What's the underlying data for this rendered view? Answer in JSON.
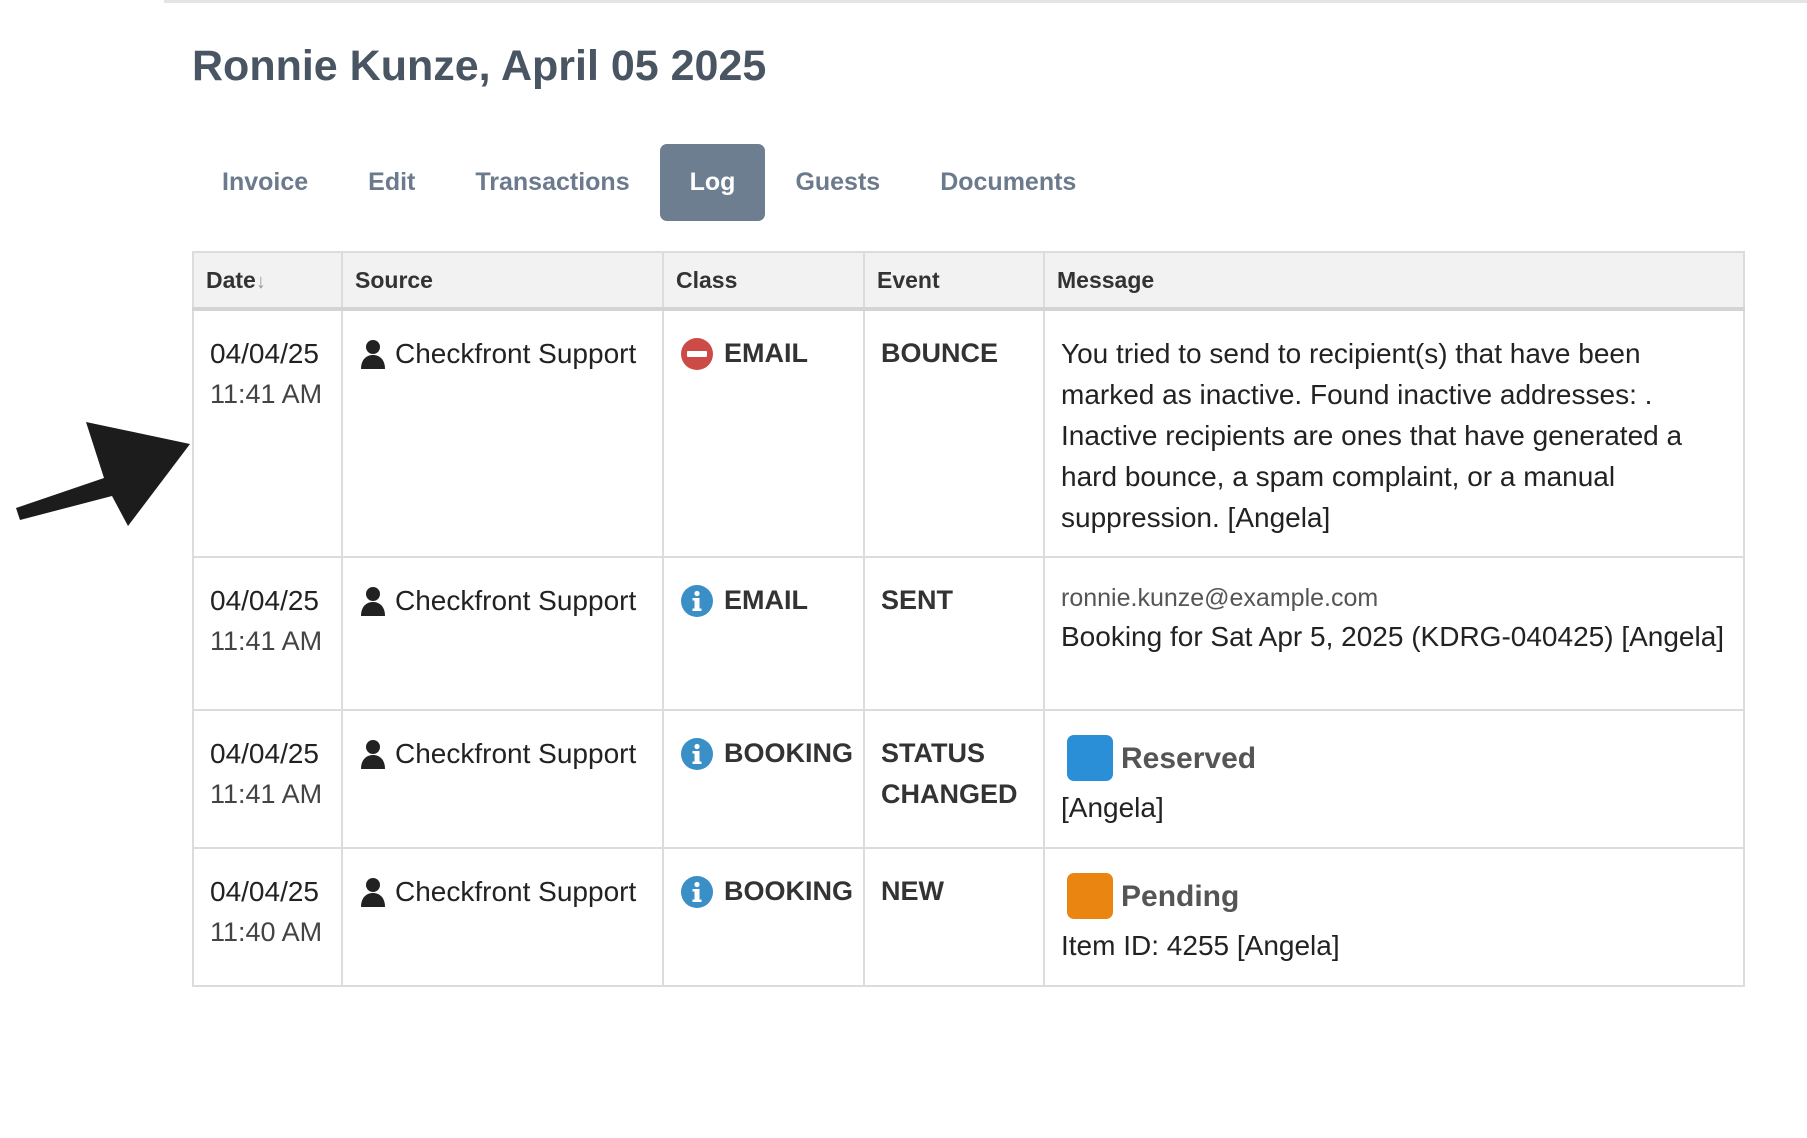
{
  "page": {
    "title": "Ronnie Kunze, April 05 2025"
  },
  "tabs": [
    {
      "label": "Invoice",
      "active": false
    },
    {
      "label": "Edit",
      "active": false
    },
    {
      "label": "Transactions",
      "active": false
    },
    {
      "label": "Log",
      "active": true
    },
    {
      "label": "Guests",
      "active": false
    },
    {
      "label": "Documents",
      "active": false
    }
  ],
  "table": {
    "columns": {
      "date": "Date",
      "date_sort_icon": "↓",
      "source": "Source",
      "class": "Class",
      "event": "Event",
      "message": "Message"
    },
    "rows": [
      {
        "date": "04/04/25",
        "time": "11:41 AM",
        "source": "Checkfront Support",
        "class_icon": "no-entry-icon",
        "class": "EMAIL",
        "event": "BOUNCE",
        "message": "You tried to send to recipient(s) that have been marked as inactive. Found inactive addresses: . Inactive recipients are ones that have generated a hard bounce, a spam complaint, or a manual suppression. [Angela]"
      },
      {
        "date": "04/04/25",
        "time": "11:41 AM",
        "source": "Checkfront Support",
        "class_icon": "info-icon",
        "class": "EMAIL",
        "event": "SENT",
        "message_email": "ronnie.kunze@example.com",
        "message": "Booking for Sat Apr 5, 2025 (KDRG-040425) [Angela]"
      },
      {
        "date": "04/04/25",
        "time": "11:41 AM",
        "source": "Checkfront Support",
        "class_icon": "info-icon",
        "class": "BOOKING",
        "event": "STATUS CHANGED",
        "badge_label": "Reserved",
        "badge_color": "#2a8fd6",
        "message": "[Angela]"
      },
      {
        "date": "04/04/25",
        "time": "11:40 AM",
        "source": "Checkfront Support",
        "class_icon": "info-icon",
        "class": "BOOKING",
        "event": "NEW",
        "badge_label": "Pending",
        "badge_color": "#ea8511",
        "message": "Item ID: 4255 [Angela]"
      }
    ]
  },
  "colors": {
    "title": "#4a5563",
    "tab_text": "#6b7a8c",
    "tab_active_bg": "#6e7e91",
    "error_icon": "#cc4b47",
    "info_icon": "#3a8fc6"
  },
  "annotation": {
    "arrow_icon": "arrow-pointer-icon"
  }
}
